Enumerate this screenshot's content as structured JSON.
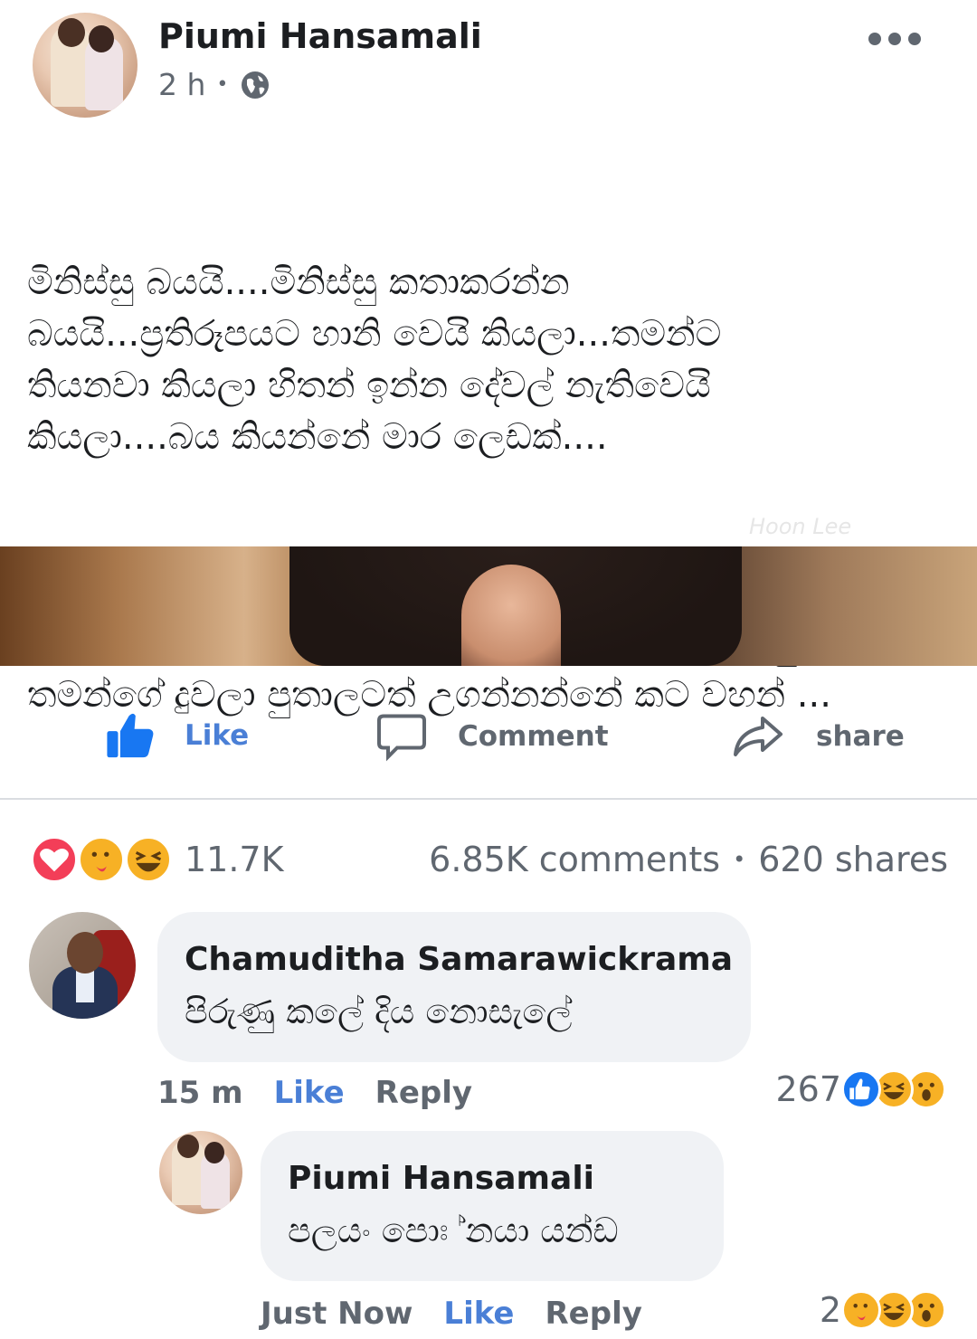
{
  "post": {
    "author": "Piumi Hansamali",
    "time": "2 h",
    "meta_separator": "•",
    "privacy_icon": "globe-icon",
    "more_icon": "more-dots-icon",
    "paragraphs": [
      "මිනිස්සු බයයි....මිනිස්සු කතාකරන්න\nබයයි...ප්‍රතිරූපයට හානි වෙයි කියලා...තමන්ට\nතියනවා කියලා හිතන් ඉන්න දේවල් නැතිවෙයි\nකියලා....බය කියන්නේ මාර ලෙඩක්....",
      "පොඩි කාලේ ඉදන්ම ලංකාවේ උගත් වැදගත් මිනිස්සු\nතමන්ගේ දුවලා පුතාලටත් උගන්නන්නේ කට වහන් ..."
    ],
    "watermark": "Hoon Lee"
  },
  "actions": {
    "like_label": "Like",
    "comment_label": "Comment",
    "share_label": "share"
  },
  "stats": {
    "reaction_count": "11.7K",
    "comments": "6.85K comments",
    "separator": "•",
    "shares": "620 shares"
  },
  "comments": [
    {
      "author": "Chamuditha Samarawickrama",
      "text": "පිරුණු කලේ දිය නොසැලේ",
      "time": "15 m",
      "like_label": "Like",
      "reply_label": "Reply",
      "reaction_count": "267"
    },
    {
      "author": "Piumi Hansamali",
      "text": "පලයං පොඃ  ්නයා යන්ඩ",
      "time": "Just Now",
      "like_label": "Like",
      "reply_label": "Reply",
      "reaction_count": "2"
    }
  ],
  "colors": {
    "accent_blue": "#1877f2",
    "text_primary": "#1c1e21",
    "text_secondary": "#606770",
    "bubble_bg": "#f0f2f5",
    "love_red": "#f33e58",
    "haha_yellow": "#f7b125"
  }
}
